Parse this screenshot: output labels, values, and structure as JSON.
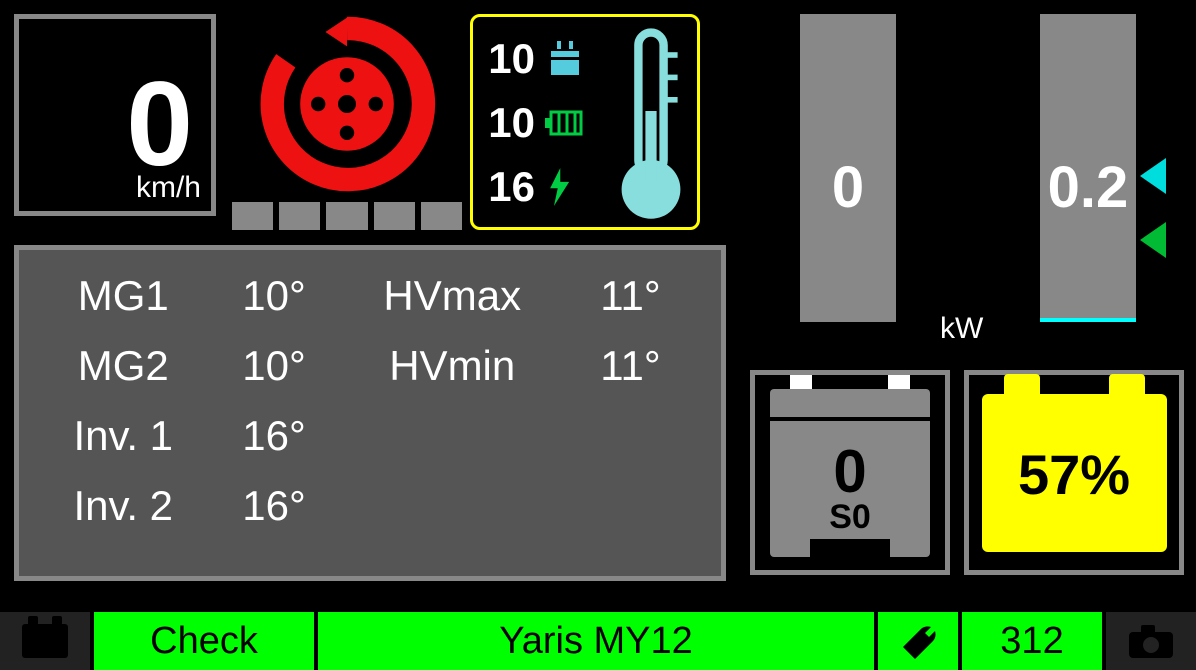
{
  "speed": {
    "value": "0",
    "unit": "km/h"
  },
  "temps": {
    "engine": "10",
    "battery": "10",
    "inverter": "16"
  },
  "table": {
    "mg1_label": "MG1",
    "mg1_val": "10°",
    "mg2_label": "MG2",
    "mg2_val": "10°",
    "inv1_label": "Inv. 1",
    "inv1_val": "16°",
    "inv2_label": "Inv. 2",
    "inv2_val": "16°",
    "hvmax_label": "HVmax",
    "hvmax_val": "11°",
    "hvmin_label": "HVmin",
    "hvmin_val": "11°"
  },
  "gauge_a": {
    "value": "0"
  },
  "gauge_b": {
    "value": "0.2",
    "unit": "kW"
  },
  "engine": {
    "value": "0",
    "sub": "S0"
  },
  "battery": {
    "pct": "57%"
  },
  "footer": {
    "check": "Check",
    "vehicle": "Yaris MY12",
    "count": "312"
  },
  "colors": {
    "accent_green": "#0f0",
    "accent_yellow": "#ff0",
    "accent_cyan": "#5ce",
    "accent_red": "#e11"
  }
}
